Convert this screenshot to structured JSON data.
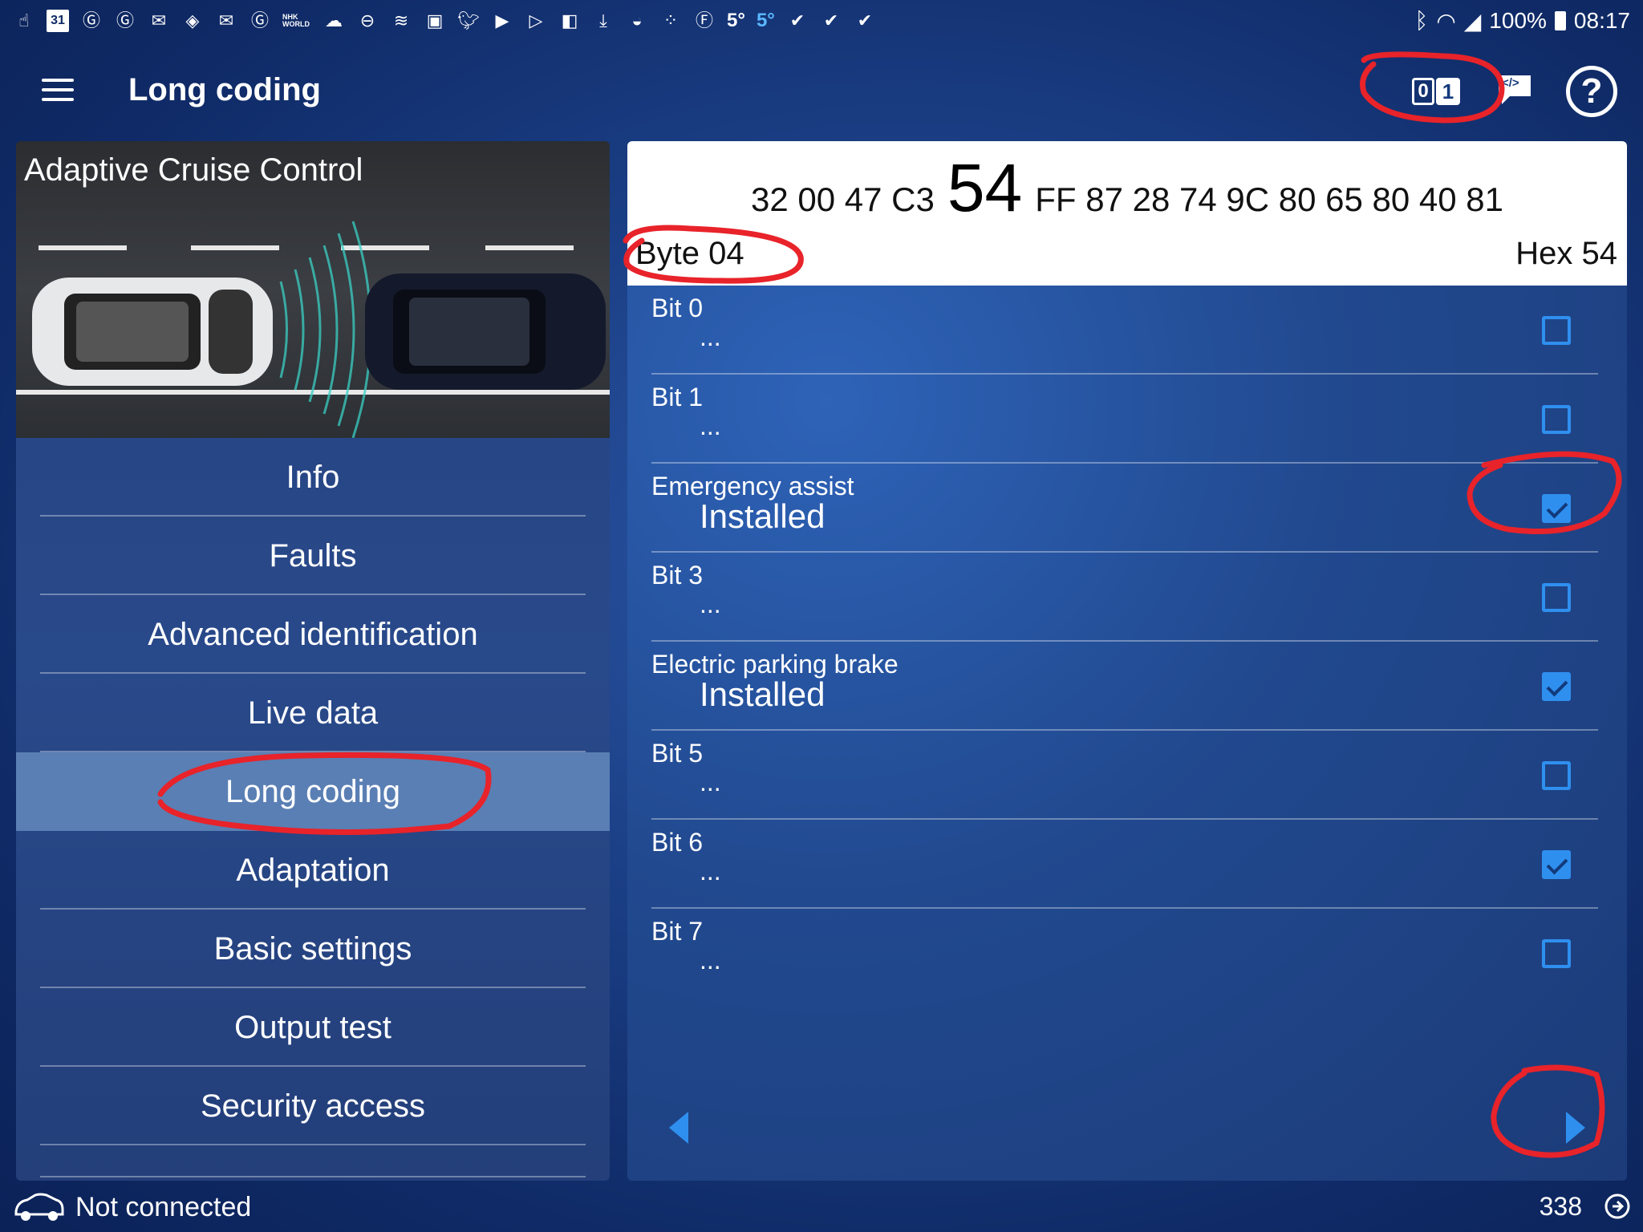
{
  "status_bar": {
    "left_icons": [
      "hand-icon",
      "calendar-icon",
      "g-circle-icon",
      "g-circle-icon",
      "mail-icon",
      "diamond-icon",
      "mail-icon",
      "g-circle-icon",
      "nhk-world-icon",
      "cloud-icon",
      "minus-circle-icon",
      "wind-icon",
      "image-icon",
      "twitter-icon",
      "youtube-icon",
      "play-icon",
      "flipboard-icon",
      "download-icon",
      "bag-icon",
      "dots-icon",
      "f-icon",
      "weather-icon",
      "weather-icon",
      "gv-icon",
      "gv-icon",
      "gv-icon"
    ],
    "calendar_day": "31",
    "nhk_label": "NHK WORLD",
    "temp_1": "5°",
    "temp_2": "5°",
    "battery": "100%",
    "time": "08:17"
  },
  "app_bar": {
    "title": "Long coding",
    "binary_zero": "0",
    "binary_one": "1",
    "code_icon_label": "</>",
    "help_symbol": "?"
  },
  "left_panel": {
    "hero_title": "Adaptive Cruise Control",
    "nav_items": [
      {
        "label": "Info"
      },
      {
        "label": "Faults"
      },
      {
        "label": "Advanced identification"
      },
      {
        "label": "Live data"
      },
      {
        "label": "Long coding",
        "active": true
      },
      {
        "label": "Adaptation"
      },
      {
        "label": "Basic settings"
      },
      {
        "label": "Output test"
      },
      {
        "label": "Security access"
      }
    ]
  },
  "coding": {
    "bytes_before": "32 00 47 C3",
    "current_byte": "54",
    "bytes_after": "FF 87 28 74 9C 80 65 80 40 81",
    "byte_label": "Byte 04",
    "hex_label": "Hex 54",
    "bits": [
      {
        "name": "Bit 0",
        "value": "...",
        "checked": false
      },
      {
        "name": "Bit 1",
        "value": "...",
        "checked": false
      },
      {
        "name": "Emergency assist",
        "value": "Installed",
        "checked": true
      },
      {
        "name": "Bit 3",
        "value": "...",
        "checked": false
      },
      {
        "name": "Electric parking brake",
        "value": "Installed",
        "checked": true
      },
      {
        "name": "Bit 5",
        "value": "...",
        "checked": false
      },
      {
        "name": "Bit 6",
        "value": "...",
        "checked": true
      },
      {
        "name": "Bit 7",
        "value": "...",
        "checked": false
      }
    ]
  },
  "bottom_bar": {
    "connection_status": "Not connected",
    "counter": "338"
  },
  "colors": {
    "accent": "#2f8fef",
    "annotation": "#e8232a",
    "active_nav": "#5a7fb4"
  }
}
